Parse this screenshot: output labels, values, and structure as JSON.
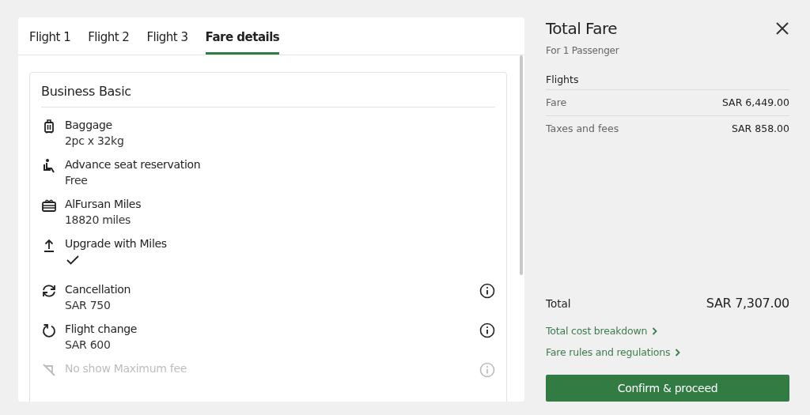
{
  "tabs": [
    {
      "label": "Flight 1",
      "selected": false
    },
    {
      "label": "Flight 2",
      "selected": false
    },
    {
      "label": "Flight 3",
      "selected": false
    },
    {
      "label": "Fare details",
      "selected": true
    }
  ],
  "fare_card": {
    "title": "Business Basic",
    "items": [
      {
        "label": "Baggage",
        "kind": "text",
        "value": "2pc x 32kg",
        "info": false,
        "faded": false
      },
      {
        "label": "Advance seat reservation",
        "kind": "text",
        "value": "Free",
        "info": false,
        "faded": false
      },
      {
        "label": "AlFursan Miles",
        "kind": "text",
        "value": "18820 miles",
        "info": false,
        "faded": false
      },
      {
        "label": "Upgrade with Miles",
        "kind": "check",
        "info": false,
        "faded": false
      },
      {
        "label": "Cancellation",
        "kind": "text",
        "value": "SAR 750",
        "info": true,
        "faded": false
      },
      {
        "label": "Flight change",
        "kind": "text",
        "value": "SAR 600",
        "info": true,
        "faded": false
      },
      {
        "label": "No show Maximum fee",
        "kind": "none",
        "info": true,
        "faded": true
      }
    ]
  },
  "summary": {
    "title": "Total Fare",
    "subtitle": "For 1 Passenger",
    "section": "Flights",
    "lines": [
      {
        "label": "Fare",
        "amount": "SAR 6,449.00"
      },
      {
        "label": "Taxes and fees",
        "amount": "SAR 858.00"
      }
    ],
    "total_label": "Total",
    "total_amount": "SAR 7,307.00",
    "links": [
      "Total cost breakdown",
      "Fare rules and regulations"
    ],
    "button": "Confirm & proceed"
  }
}
